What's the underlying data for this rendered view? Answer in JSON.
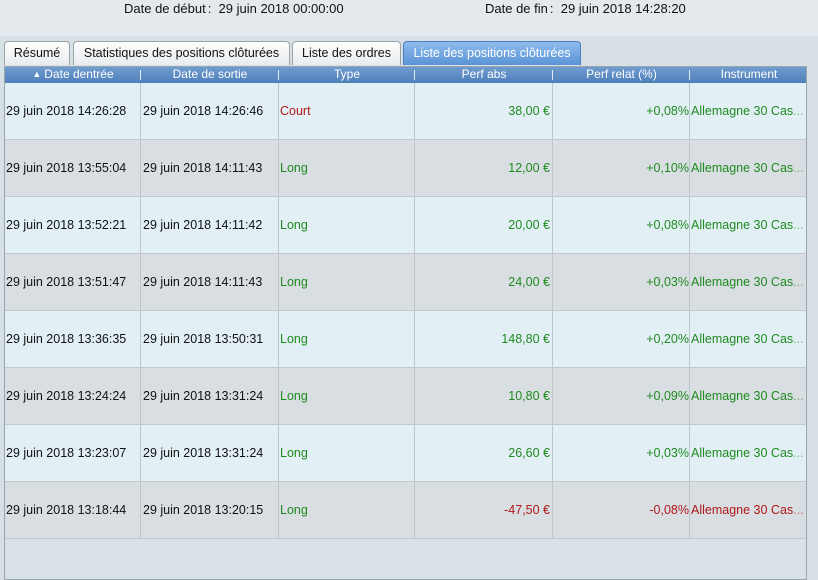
{
  "header": {
    "start_label": "Date de début",
    "start_value": "29 juin 2018 00:00:00",
    "end_label": "Date de fin",
    "end_value": "29 juin 2018 14:28:20"
  },
  "tabs": [
    {
      "label": "Résumé",
      "active": false
    },
    {
      "label": "Statistiques des positions clôturées",
      "active": false
    },
    {
      "label": "Liste des ordres",
      "active": false
    },
    {
      "label": "Liste des positions clôturées",
      "active": true
    }
  ],
  "table": {
    "columns": [
      "Date dentrée",
      "Date de sortie",
      "Type",
      "Perf abs",
      "Perf relat (%)",
      "Instrument"
    ],
    "sort_icon": "sort-up-icon",
    "rows": [
      {
        "entry": "29 juin 2018 14:26:28",
        "exit": "29 juin 2018 14:26:46",
        "type": "Court",
        "abs": "38,00 €",
        "rel": "+0,08%",
        "instrument": "Allemagne 30 Cas",
        "type_color": "red",
        "perf_color": "green"
      },
      {
        "entry": "29 juin 2018 13:55:04",
        "exit": "29 juin 2018 14:11:43",
        "type": "Long",
        "abs": "12,00 €",
        "rel": "+0,10%",
        "instrument": "Allemagne 30 Cas",
        "type_color": "green",
        "perf_color": "green"
      },
      {
        "entry": "29 juin 2018 13:52:21",
        "exit": "29 juin 2018 14:11:42",
        "type": "Long",
        "abs": "20,00 €",
        "rel": "+0,08%",
        "instrument": "Allemagne 30 Cas",
        "type_color": "green",
        "perf_color": "green"
      },
      {
        "entry": "29 juin 2018 13:51:47",
        "exit": "29 juin 2018 14:11:43",
        "type": "Long",
        "abs": "24,00 €",
        "rel": "+0,03%",
        "instrument": "Allemagne 30 Cas",
        "type_color": "green",
        "perf_color": "green"
      },
      {
        "entry": "29 juin 2018 13:36:35",
        "exit": "29 juin 2018 13:50:31",
        "type": "Long",
        "abs": "148,80 €",
        "rel": "+0,20%",
        "instrument": "Allemagne 30 Cas",
        "type_color": "green",
        "perf_color": "green"
      },
      {
        "entry": "29 juin 2018 13:24:24",
        "exit": "29 juin 2018 13:31:24",
        "type": "Long",
        "abs": "10,80 €",
        "rel": "+0,09%",
        "instrument": "Allemagne 30 Cas",
        "type_color": "green",
        "perf_color": "green"
      },
      {
        "entry": "29 juin 2018 13:23:07",
        "exit": "29 juin 2018 13:31:24",
        "type": "Long",
        "abs": "26,60 €",
        "rel": "+0,03%",
        "instrument": "Allemagne 30 Cas",
        "type_color": "green",
        "perf_color": "green"
      },
      {
        "entry": "29 juin 2018 13:18:44",
        "exit": "29 juin 2018 13:20:15",
        "type": "Long",
        "abs": "-47,50 €",
        "rel": "-0,08%",
        "instrument": "Allemagne 30 Cas",
        "type_color": "green",
        "perf_color": "red"
      }
    ]
  },
  "colors": {
    "green": "#1f8a1f",
    "red": "#b01818",
    "header_blue": "#5a8ac8",
    "active_tab": "#6a9fdf"
  }
}
